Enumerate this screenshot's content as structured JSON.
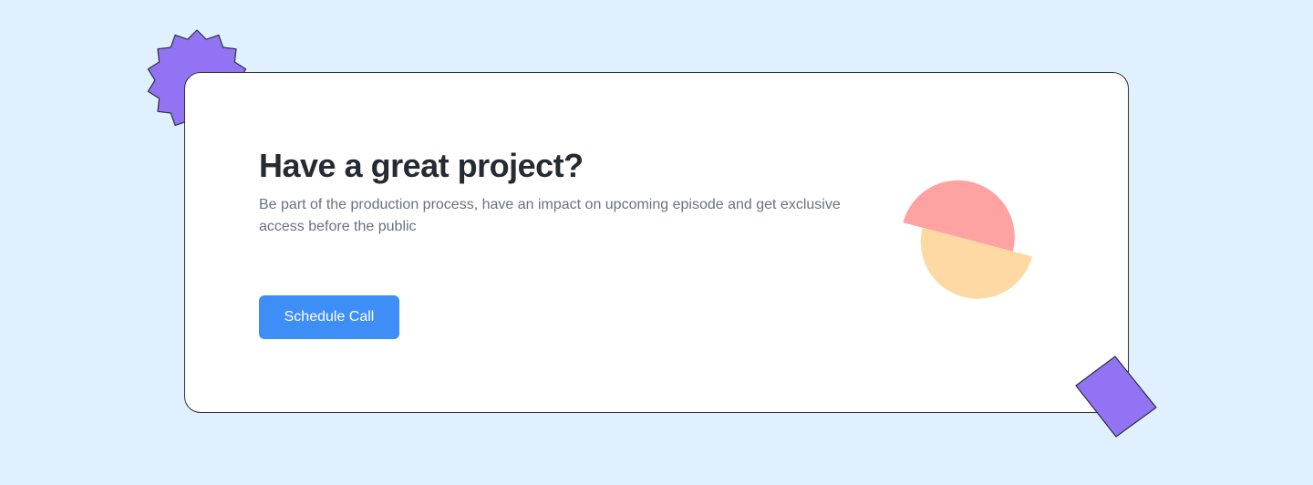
{
  "cta_section": {
    "headline": "Have a great project?",
    "description": "Be part of the production process, have an impact on upcoming episode and get exclusive access before the public",
    "button_label": "Schedule Call"
  },
  "colors": {
    "page_background": "#e0f0fe",
    "card_background": "#ffffff",
    "card_border": "#2d3139",
    "accent_purple": "#9173f4",
    "button_blue": "#3e8ef7",
    "circle_pink": "#fea3a2",
    "circle_peach": "#ffd9a3"
  }
}
